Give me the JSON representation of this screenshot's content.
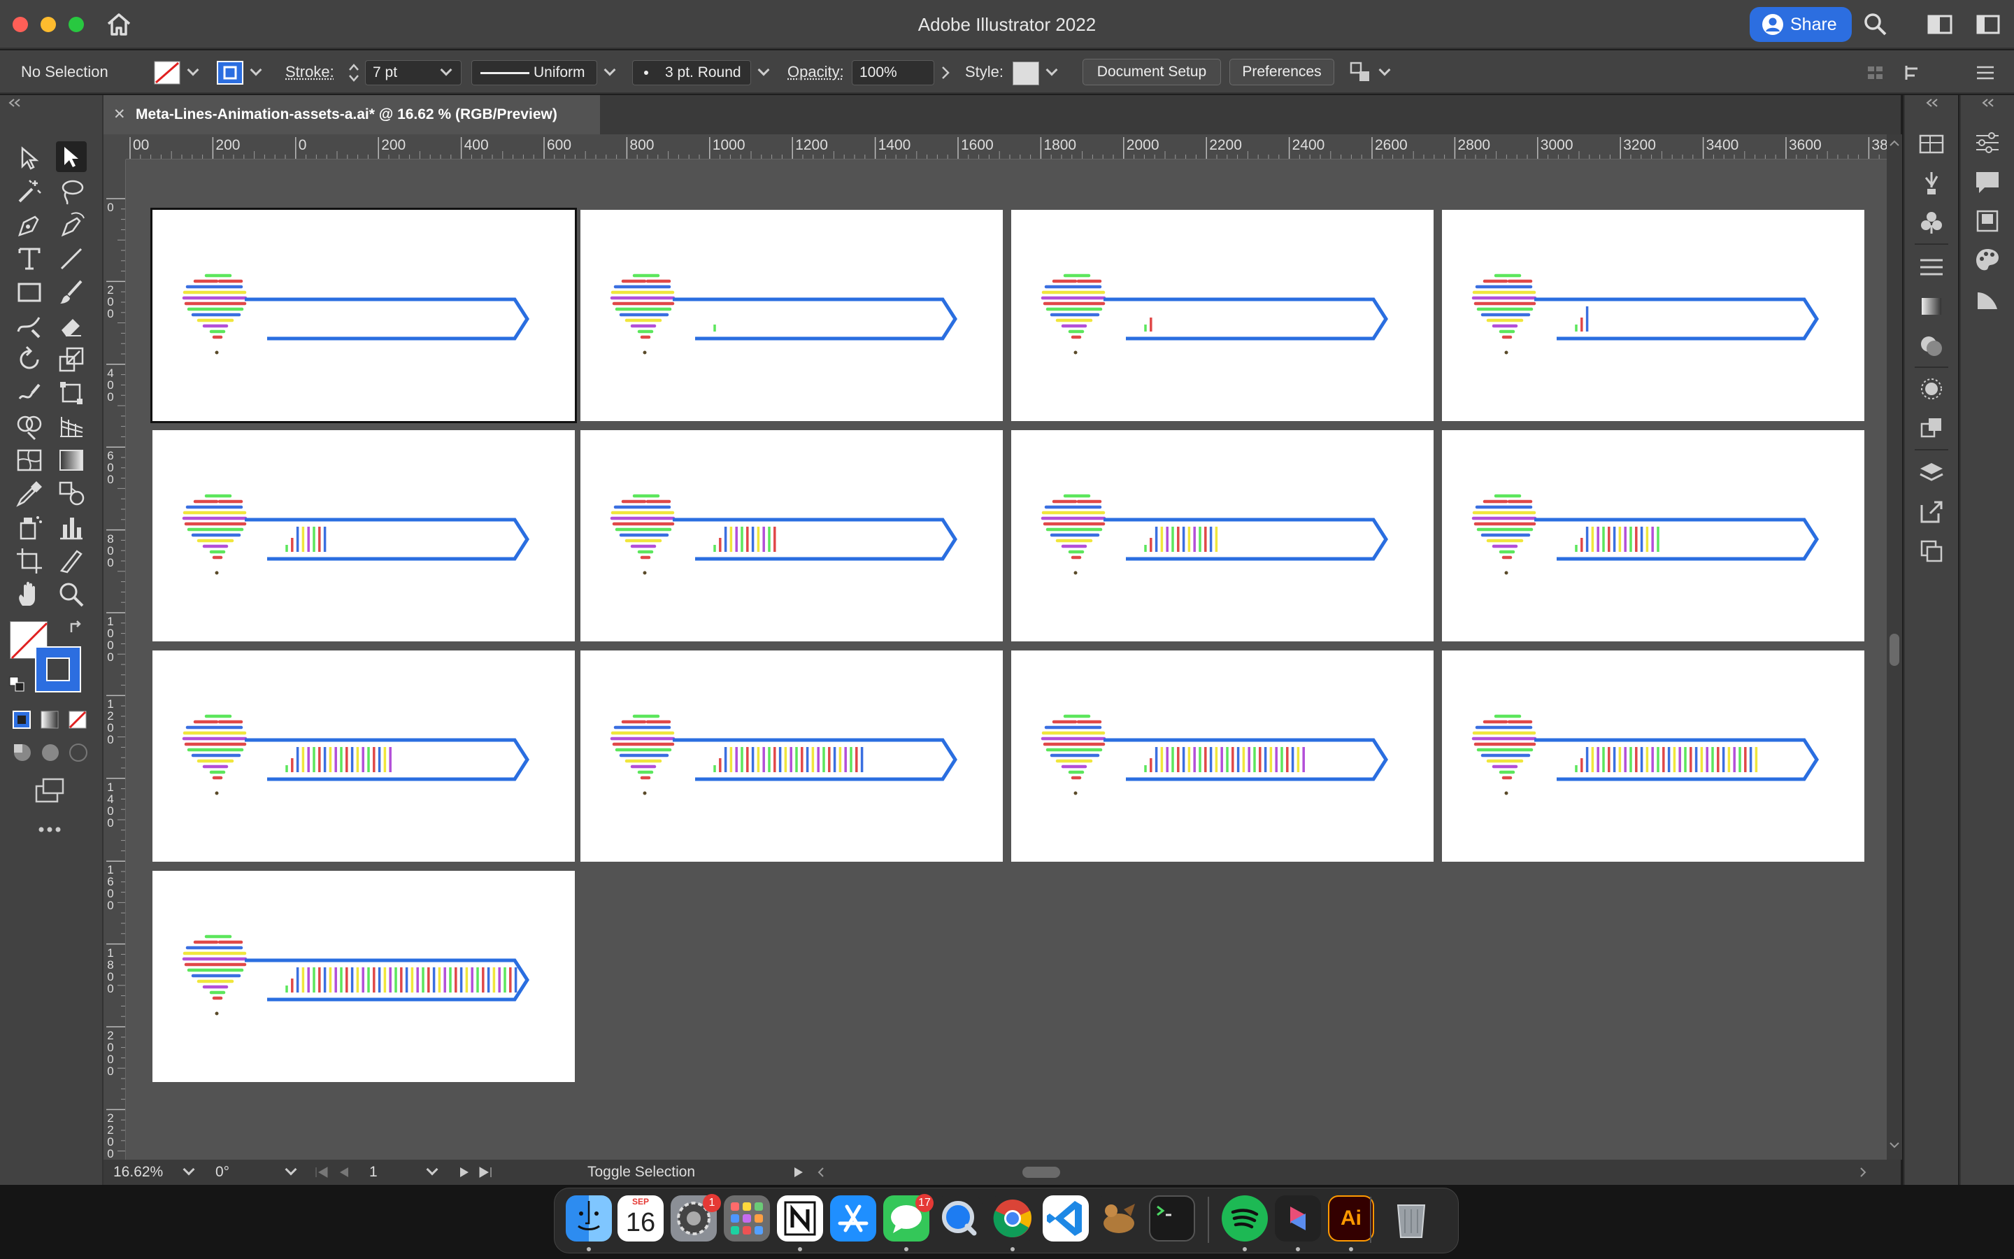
{
  "app": {
    "title": "Adobe Illustrator 2022",
    "share_label": "Share"
  },
  "control_bar": {
    "selection": "No Selection",
    "stroke_label": "Stroke:",
    "stroke_weight": "7 pt",
    "stroke_profile": "Uniform",
    "brush": "3 pt. Round",
    "opacity_label": "Opacity:",
    "opacity_value": "100%",
    "style_label": "Style:",
    "document_setup": "Document Setup",
    "preferences": "Preferences"
  },
  "document_tab": {
    "title": "Meta-Lines-Animation-assets-a.ai* @ 16.62 % (RGB/Preview)"
  },
  "ruler": {
    "horizontal": [
      "00",
      "200",
      "0",
      "200",
      "400",
      "600",
      "800",
      "1000",
      "1200",
      "1400",
      "1600",
      "1800",
      "2000",
      "2200",
      "2400",
      "2600",
      "2800",
      "3000",
      "3200",
      "3400",
      "3600",
      "380("
    ],
    "vertical": [
      "0",
      "200",
      "400",
      "600",
      "800",
      "1000",
      "1200",
      "1400",
      "1600",
      "1800",
      "2000",
      "2200"
    ]
  },
  "artboards": {
    "count": 13,
    "progress_bars_shown": [
      0,
      1,
      2,
      3,
      8,
      12,
      14,
      16,
      20,
      28,
      30,
      34,
      44
    ]
  },
  "status_bar": {
    "zoom": "16.62%",
    "rotation": "0°",
    "artboard_number": "1",
    "status_text": "Toggle Selection"
  },
  "colors": {
    "accent": "#2c6ee0",
    "arrow_blue": "#2a6ee0",
    "rainbow": [
      "#5ce65c",
      "#e04848",
      "#3a6fe0",
      "#f0e63c",
      "#b34fd8"
    ]
  },
  "dock": {
    "items": [
      "Finder",
      "Calendar",
      "System Preferences",
      "Launchpad",
      "Notion",
      "App Store",
      "Messages",
      "QuickTime Player",
      "Google Chrome",
      "Visual Studio Code",
      "Sequel Pro",
      "Terminal",
      "Spotify",
      "Setapp",
      "Adobe Illustrator",
      "Trash"
    ],
    "calendar_month": "SEP",
    "calendar_day": "16",
    "sysprefs_badge": "1",
    "messages_badge": "17",
    "illustrator_label": "Ai"
  }
}
